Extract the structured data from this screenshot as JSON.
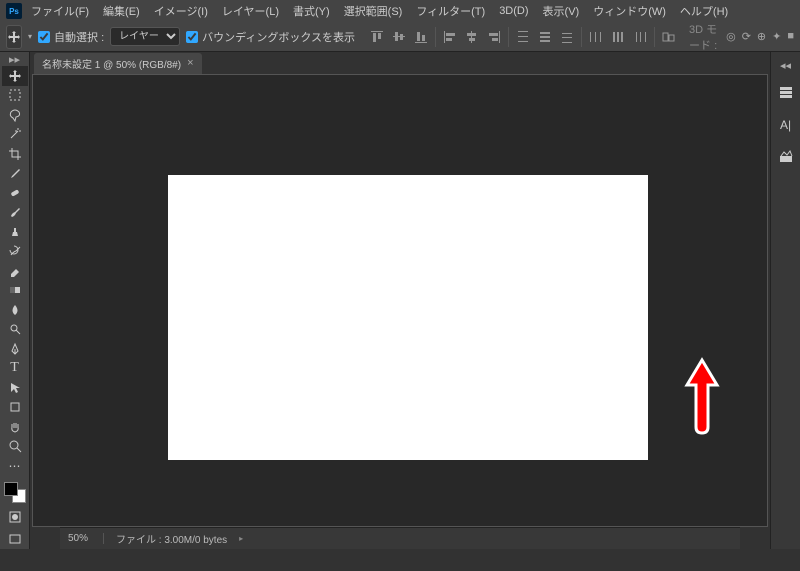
{
  "menus": [
    "ファイル(F)",
    "編集(E)",
    "イメージ(I)",
    "レイヤー(L)",
    "書式(Y)",
    "選択範囲(S)",
    "フィルター(T)",
    "3D(D)",
    "表示(V)",
    "ウィンドウ(W)",
    "ヘルプ(H)"
  ],
  "optionsBar": {
    "autoSelectLabel": "自動選択 :",
    "autoSelectChecked": true,
    "layerSelect": "レイヤー",
    "showBoundingLabel": "バウンディングボックスを表示",
    "showBoundingChecked": true,
    "mode3dLabel": "3D モード :"
  },
  "documentTab": {
    "title": "名称未設定 1 @ 50% (RGB/8#)"
  },
  "statusBar": {
    "zoom": "50%",
    "fileInfo": "ファイル : 3.00M/0 bytes"
  },
  "leftTools": [
    {
      "name": "move-tool",
      "glyph": "move",
      "selected": true
    },
    {
      "name": "marquee-tool",
      "glyph": "marquee"
    },
    {
      "name": "lasso-tool",
      "glyph": "lasso"
    },
    {
      "name": "wand-tool",
      "glyph": "wand"
    },
    {
      "name": "crop-tool",
      "glyph": "crop"
    },
    {
      "name": "eyedropper-tool",
      "glyph": "eyedropper"
    },
    {
      "name": "healing-tool",
      "glyph": "bandaid"
    },
    {
      "name": "brush-tool",
      "glyph": "brush"
    },
    {
      "name": "stamp-tool",
      "glyph": "stamp"
    },
    {
      "name": "history-brush-tool",
      "glyph": "history"
    },
    {
      "name": "eraser-tool",
      "glyph": "eraser"
    },
    {
      "name": "gradient-tool",
      "glyph": "gradient"
    },
    {
      "name": "blur-tool",
      "glyph": "blur"
    },
    {
      "name": "dodge-tool",
      "glyph": "dodge"
    },
    {
      "name": "pen-tool",
      "glyph": "pen"
    },
    {
      "name": "type-tool",
      "glyph": "T"
    },
    {
      "name": "path-tool",
      "glyph": "path"
    },
    {
      "name": "rectangle-tool",
      "glyph": "rect"
    },
    {
      "name": "hand-tool",
      "glyph": "hand"
    },
    {
      "name": "zoom-tool",
      "glyph": "zoom"
    }
  ],
  "rightPanels": [
    {
      "name": "history-panel",
      "glyph": "layers"
    },
    {
      "name": "character-panel",
      "glyph": "A|"
    },
    {
      "name": "adjustments-panel",
      "glyph": "adjust"
    }
  ],
  "colors": {
    "accent": "#31a8ff",
    "arrow": "#ff0000",
    "arrowStroke": "#ffffff"
  }
}
